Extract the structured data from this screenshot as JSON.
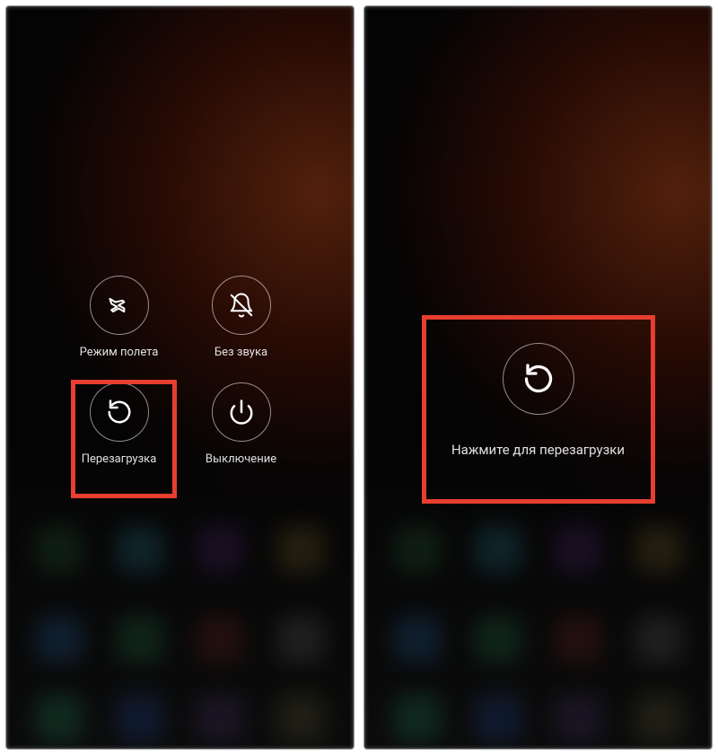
{
  "left_screen": {
    "airplane": {
      "label": "Режим полета"
    },
    "silent": {
      "label": "Без звука"
    },
    "reboot": {
      "label": "Перезагрузка"
    },
    "power_off": {
      "label": "Выключение"
    }
  },
  "right_screen": {
    "confirm_reboot": {
      "label": "Нажмите для перезагрузки"
    }
  },
  "highlight_color": "#e63e2f"
}
